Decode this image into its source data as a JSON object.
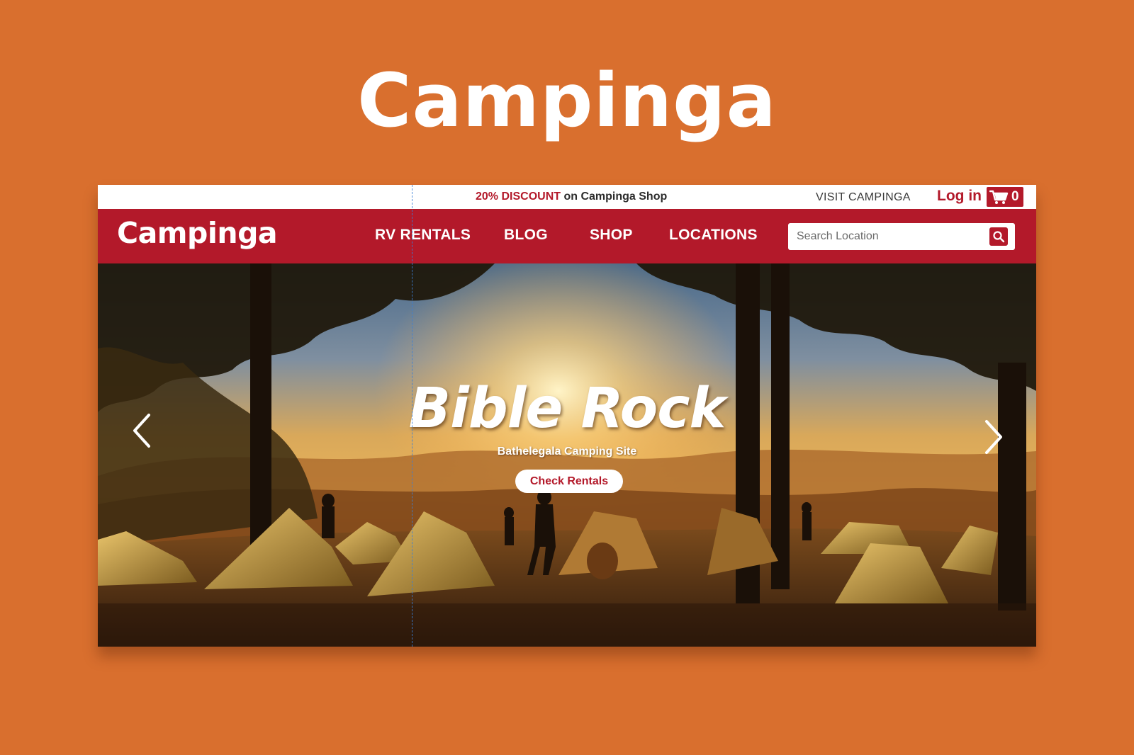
{
  "showcase": {
    "title": "Campinga"
  },
  "top_bar": {
    "discount_highlight": "20% DISCOUNT",
    "discount_rest": " on Campinga Shop",
    "visit_link": "VISIT CAMPINGA",
    "login_label": "Log in",
    "cart_count": "0",
    "cart_icon": "cart-icon"
  },
  "nav": {
    "logo": "Campinga",
    "items": [
      "RV RENTALS",
      "BLOG",
      "SHOP",
      "LOCATIONS"
    ],
    "search": {
      "placeholder": "Search Location",
      "button_icon": "search-icon"
    }
  },
  "hero": {
    "title": "Bible Rock",
    "subtitle": "Bathelegala Camping Site",
    "cta_label": "Check Rentals",
    "prev_icon": "chevron-left-icon",
    "next_icon": "chevron-right-icon"
  },
  "colors": {
    "background": "#D96F2E",
    "brand_red": "#b3192a",
    "white": "#ffffff"
  }
}
